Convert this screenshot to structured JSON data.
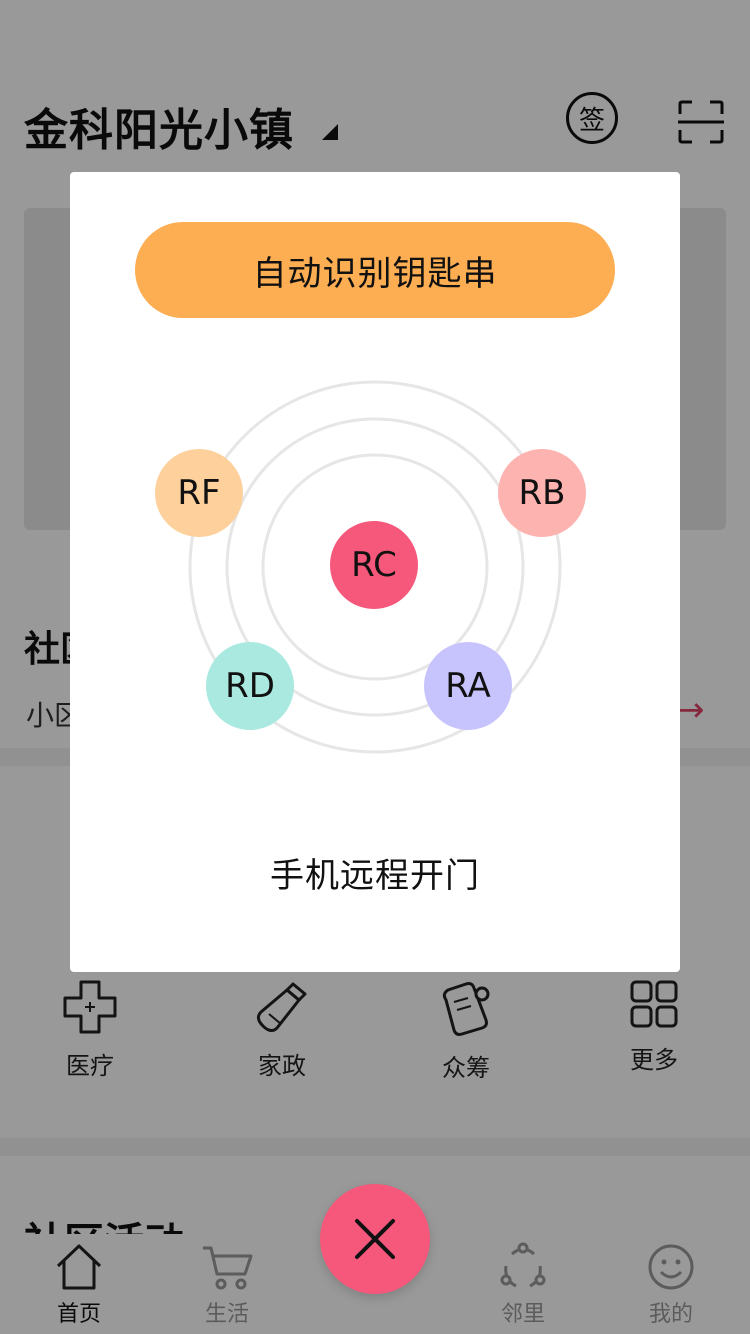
{
  "header": {
    "community_name": "金科阳光小镇",
    "sign_label": "签"
  },
  "community_section": {
    "title": "社区",
    "subtitle": "小区"
  },
  "services": [
    {
      "label": "医疗",
      "icon": "medical-cross-icon"
    },
    {
      "label": "家政",
      "icon": "broom-icon"
    },
    {
      "label": "众筹",
      "icon": "crowdfunding-icon"
    },
    {
      "label": "更多",
      "icon": "grid-icon"
    }
  ],
  "activities": {
    "title": "社区活动"
  },
  "tabbar": [
    {
      "label": "首页",
      "icon": "home-icon",
      "active": true
    },
    {
      "label": "生活",
      "icon": "cart-icon",
      "active": false
    },
    {
      "label": "邻里",
      "icon": "share-icon",
      "active": false
    },
    {
      "label": "我的",
      "icon": "smile-icon",
      "active": false
    }
  ],
  "modal": {
    "auto_detect_label": "自动识别钥匙串",
    "remote_open_label": "手机远程开门",
    "keys": [
      {
        "label": "RF",
        "color": "#fdd09c"
      },
      {
        "label": "RB",
        "color": "#fdb3b0"
      },
      {
        "label": "RC",
        "color": "#f5587a"
      },
      {
        "label": "RD",
        "color": "#a9e9e0"
      },
      {
        "label": "RA",
        "color": "#c7c3fd"
      }
    ]
  },
  "colors": {
    "accent_orange": "#fdad52",
    "close_fab": "#f5587a",
    "arrow_red": "#e0456a"
  }
}
